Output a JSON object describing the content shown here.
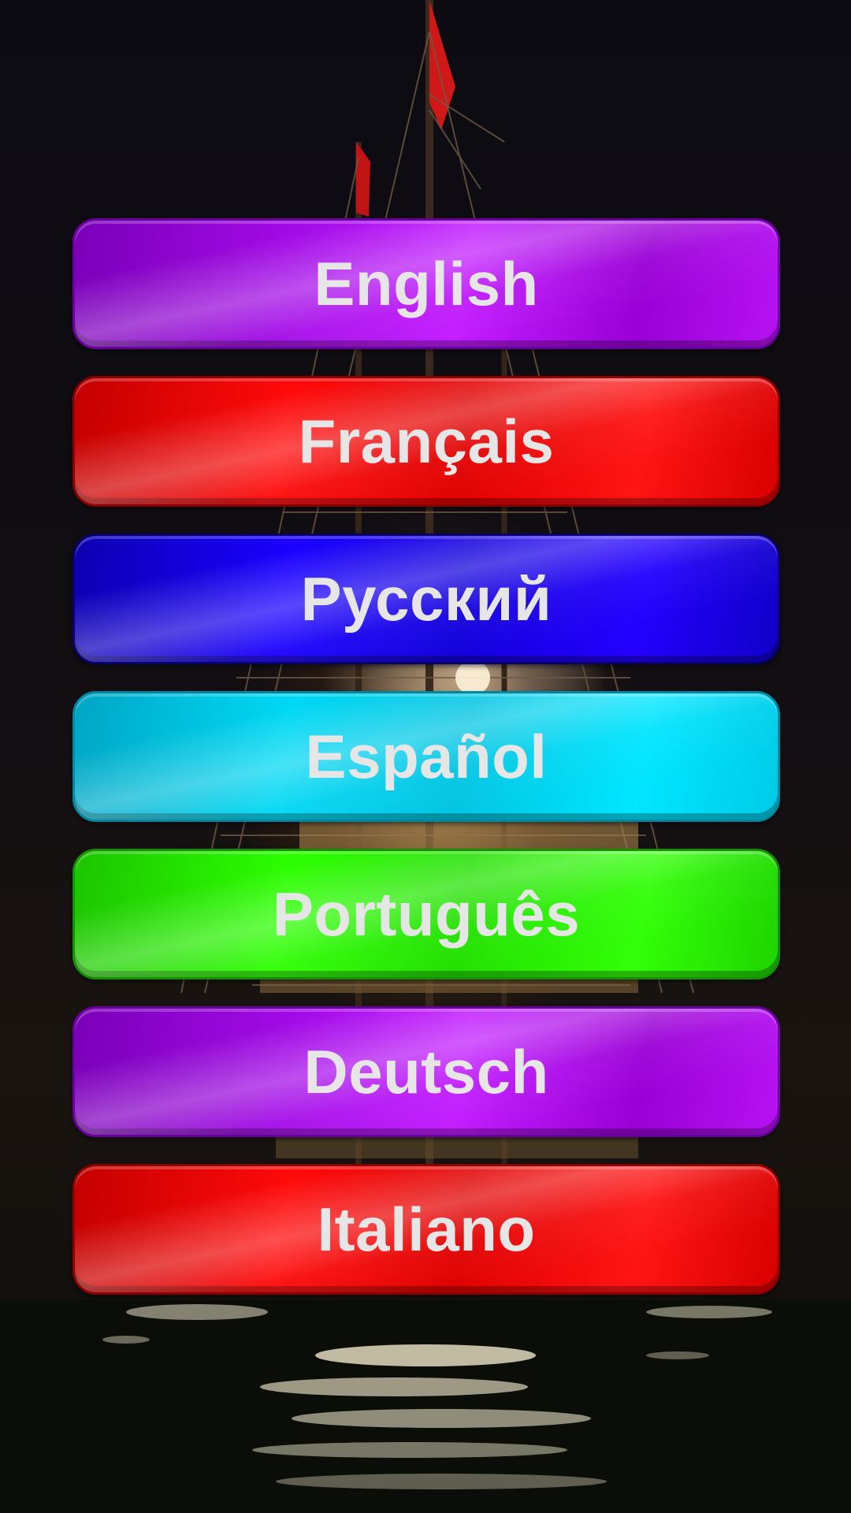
{
  "background": {
    "scene": "tall-ship-at-night"
  },
  "languages": [
    {
      "label": "English",
      "color": "#B012F0"
    },
    {
      "label": "Français",
      "color": "#F40404"
    },
    {
      "label": "Русский",
      "color": "#1A00F0"
    },
    {
      "label": "Español",
      "color": "#00D4F0"
    },
    {
      "label": "Português",
      "color": "#2CF000"
    },
    {
      "label": "Deutsch",
      "color": "#B012F0"
    },
    {
      "label": "Italiano",
      "color": "#F40404"
    }
  ]
}
